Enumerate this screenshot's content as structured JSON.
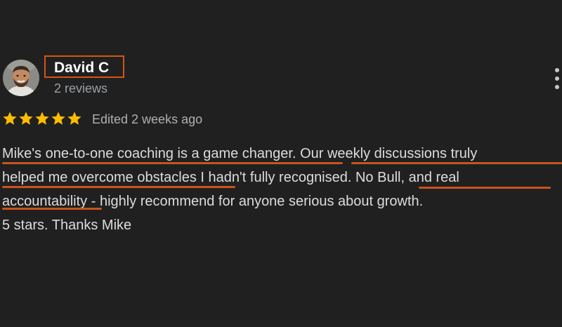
{
  "reviewer": {
    "name": "David C",
    "review_count": "2 reviews",
    "avatar_icon": "person-avatar-icon"
  },
  "rating": {
    "stars": 5,
    "max_stars": 5,
    "star_color": "#fbbc04",
    "edited_text": "Edited 2 weeks ago"
  },
  "review": {
    "lines": [
      "Mike's one-to-one coaching is a game changer. Our weekly discussions truly",
      "helped me overcome obstacles I hadn't fully recognised. No Bull, and real",
      "accountability - highly recommend for anyone serious about growth.",
      "5 stars. Thanks Mike"
    ]
  },
  "menu": {
    "icon": "more-vert-icon"
  },
  "annotation": {
    "highlight_color": "#d45512"
  }
}
